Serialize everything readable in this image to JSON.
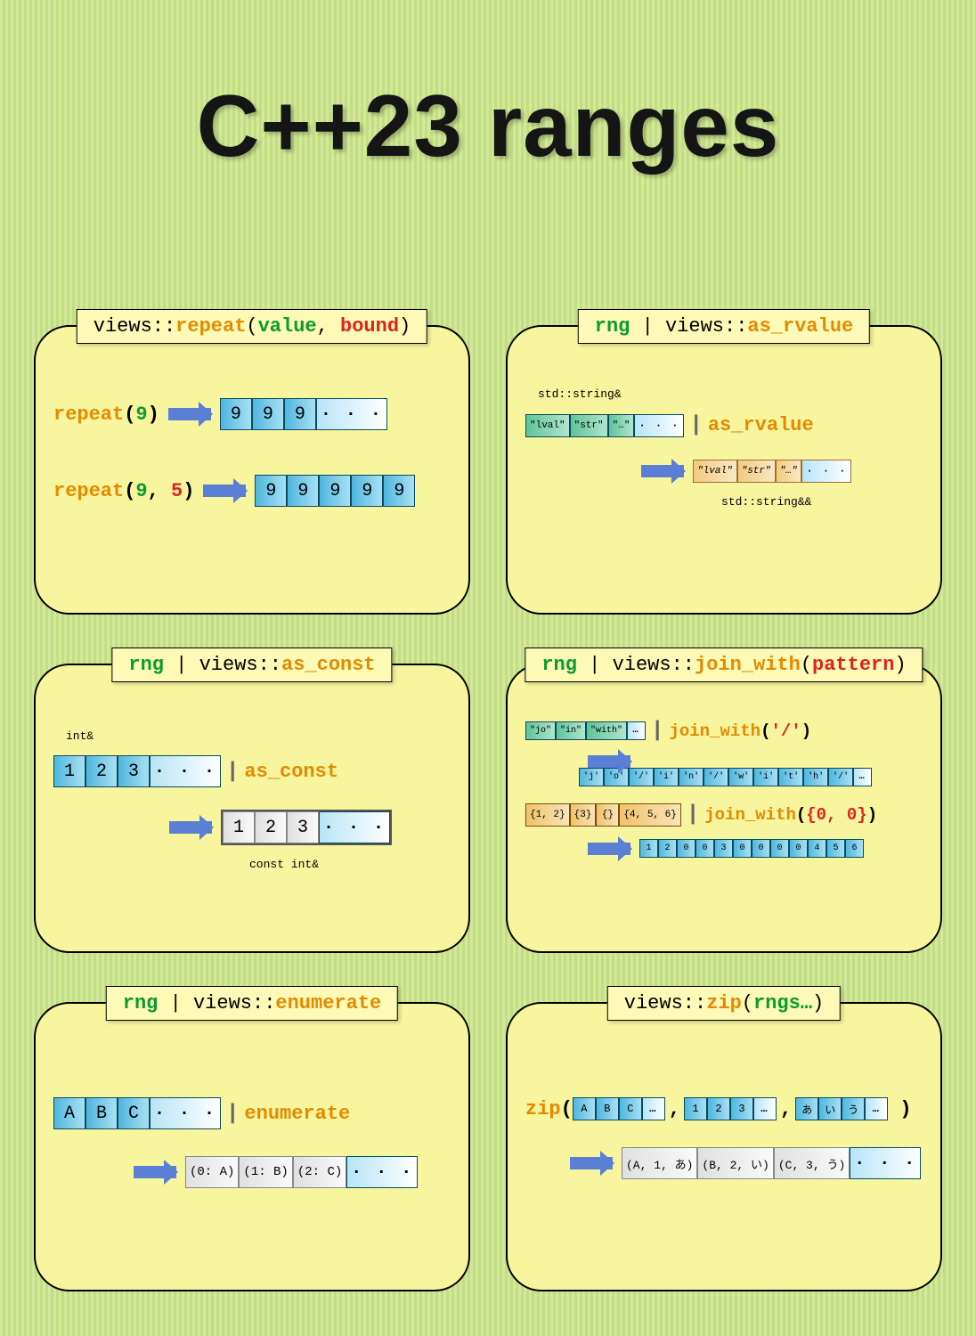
{
  "title": "C++23 ranges",
  "cards": {
    "repeat": {
      "title_parts": [
        "views::",
        "repeat",
        "(",
        "value",
        ", ",
        "bound",
        ")"
      ],
      "ex1_label": [
        "repeat",
        "(",
        "9",
        ")"
      ],
      "ex1_out": [
        "9",
        "9",
        "9",
        "· · ·"
      ],
      "ex2_label": [
        "repeat",
        "(",
        "9",
        ", ",
        "5",
        ")"
      ],
      "ex2_out": [
        "9",
        "9",
        "9",
        "9",
        "9"
      ]
    },
    "as_rvalue": {
      "title_parts": [
        "rng",
        " | views::",
        "as_rvalue"
      ],
      "note_in": "std::string&",
      "in": [
        "\"lval\"",
        "\"str\"",
        "\"…\"",
        "· · ·"
      ],
      "op": "as_rvalue",
      "out": [
        "\"lval\"",
        "\"str\"",
        "\"…\"",
        "· · ·"
      ],
      "note_out": "std::string&&"
    },
    "as_const": {
      "title_parts": [
        "rng",
        " | views::",
        "as_const"
      ],
      "note_in": "int&",
      "in": [
        "1",
        "2",
        "3",
        "· · ·"
      ],
      "op": "as_const",
      "out": [
        "1",
        "2",
        "3",
        "· · ·"
      ],
      "note_out": "const int&"
    },
    "join_with": {
      "title_parts": [
        "rng",
        " | views::",
        "join_with",
        "(",
        "pattern",
        ")"
      ],
      "ex1_in": [
        "\"jo\"",
        "\"in\"",
        "\"with\"",
        "…"
      ],
      "ex1_op": [
        "join_with",
        "(",
        "'/'",
        ")"
      ],
      "ex1_out": [
        "'j'",
        "'o'",
        "'/'",
        "'i'",
        "'n'",
        "'/'",
        "'w'",
        "'i'",
        "'t'",
        "'h'",
        "'/'",
        "…"
      ],
      "ex2_in": [
        "{1, 2}",
        "{3}",
        "{}",
        "{4, 5, 6}"
      ],
      "ex2_op": [
        "join_with",
        "(",
        "{0, 0}",
        ")"
      ],
      "ex2_out": [
        "1",
        "2",
        "0",
        "0",
        "3",
        "0",
        "0",
        "0",
        "0",
        "4",
        "5",
        "6"
      ]
    },
    "enumerate": {
      "title_parts": [
        "rng",
        " | views::",
        "enumerate"
      ],
      "in": [
        "A",
        "B",
        "C",
        "· · ·"
      ],
      "op": "enumerate",
      "out": [
        "(0: A)",
        "(1: B)",
        "(2: C)",
        "· · ·"
      ]
    },
    "zip": {
      "title_parts": [
        "views::",
        "zip",
        "(",
        "rngs…",
        ")"
      ],
      "label": "zip",
      "rngs": [
        [
          "A",
          "B",
          "C",
          "…"
        ],
        [
          "1",
          "2",
          "3",
          "…"
        ],
        [
          "あ",
          "い",
          "う",
          "…"
        ]
      ],
      "out": [
        "(A, 1, あ)",
        "(B, 2, い)",
        "(C, 3, う)",
        "· · ·"
      ]
    }
  }
}
